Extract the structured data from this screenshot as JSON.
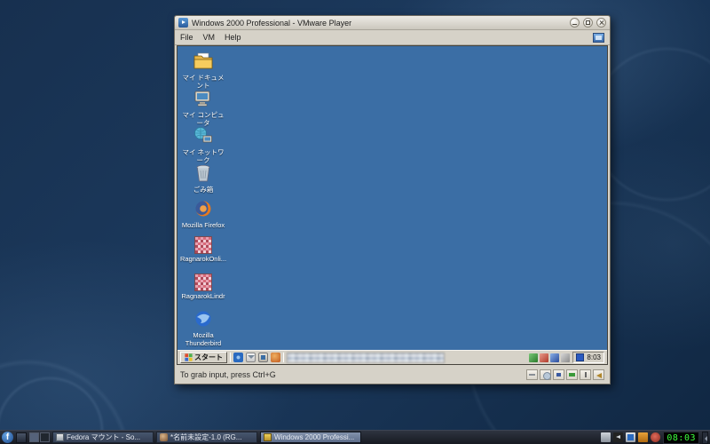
{
  "vmware": {
    "title": "Windows 2000 Professional - VMware Player",
    "menu": {
      "file": "File",
      "vm": "VM",
      "help": "Help"
    },
    "status_text": "To grab input, press Ctrl+G",
    "device_icons": [
      "hard-disk",
      "cd-rom",
      "floppy",
      "network",
      "usb",
      "sound"
    ]
  },
  "vm": {
    "desktop_icons": [
      {
        "label": "マイ ドキュメント",
        "type": "my-documents"
      },
      {
        "label": "マイ コンピュータ",
        "type": "my-computer"
      },
      {
        "label": "マイ ネットワーク",
        "type": "my-network"
      },
      {
        "label": "ごみ箱",
        "type": "recycle-bin"
      },
      {
        "label": "Mozilla Firefox",
        "type": "firefox"
      },
      {
        "label": "RagnarokOnli...",
        "type": "application"
      },
      {
        "label": "RagnarokLindr",
        "type": "application"
      },
      {
        "label": "Mozilla Thunderbird",
        "type": "thunderbird"
      }
    ],
    "taskbar": {
      "start_label": "スタート",
      "clock": "8:03"
    }
  },
  "host": {
    "tasks": [
      {
        "label": "Fedora マウント - So...",
        "active": false
      },
      {
        "label": "*名前未設定-1.0 (RG...",
        "active": false
      },
      {
        "label": "Windows 2000 Professi...",
        "active": true
      }
    ],
    "clock": "08:03"
  },
  "colors": {
    "vm_desktop_blue": "#3b6ea5",
    "window_chrome": "#d6d2c8",
    "host_panel_dark": "#1b202a",
    "clock_green": "#3dff3d"
  }
}
